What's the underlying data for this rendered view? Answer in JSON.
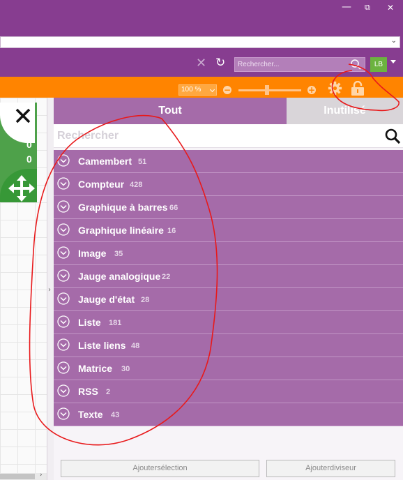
{
  "window": {
    "minimize_glyph": "—",
    "maximize_glyph": "⧉",
    "close_glyph": "✕"
  },
  "toolbar": {
    "search_placeholder": "Rechercher...",
    "user_initials": "LB"
  },
  "zoom": {
    "value": "100 %",
    "minus": "−",
    "plus": "+"
  },
  "widget": {
    "value_1": "0",
    "value_2": "0"
  },
  "panel": {
    "tabs": [
      {
        "label": "Tout",
        "active": true
      },
      {
        "label": "Inutilisé",
        "active": false
      }
    ],
    "search_placeholder": "Rechercher",
    "items": [
      {
        "label": "Camembert",
        "count": "51"
      },
      {
        "label": "Compteur",
        "count": "428"
      },
      {
        "label": "Graphique à barres",
        "count": "66"
      },
      {
        "label": "Graphique linéaire",
        "count": "16"
      },
      {
        "label": "Image",
        "count": "35"
      },
      {
        "label": "Jauge analogique",
        "count": "22"
      },
      {
        "label": "Jauge d'état",
        "count": "28"
      },
      {
        "label": "Liste",
        "count": "181"
      },
      {
        "label": "Liste liens",
        "count": "48"
      },
      {
        "label": "Matrice",
        "count": "30"
      },
      {
        "label": "RSS",
        "count": "2"
      },
      {
        "label": "Texte",
        "count": "43"
      }
    ],
    "footer": {
      "add_selection": "Ajoutersélection",
      "add_divider": "Ajouterdiviseur"
    }
  },
  "colors": {
    "purple": "#873d90",
    "panel_purple": "#a56ba9",
    "orange": "#ff8400",
    "green": "#4ea14a",
    "annotation_red": "#e8191b"
  }
}
